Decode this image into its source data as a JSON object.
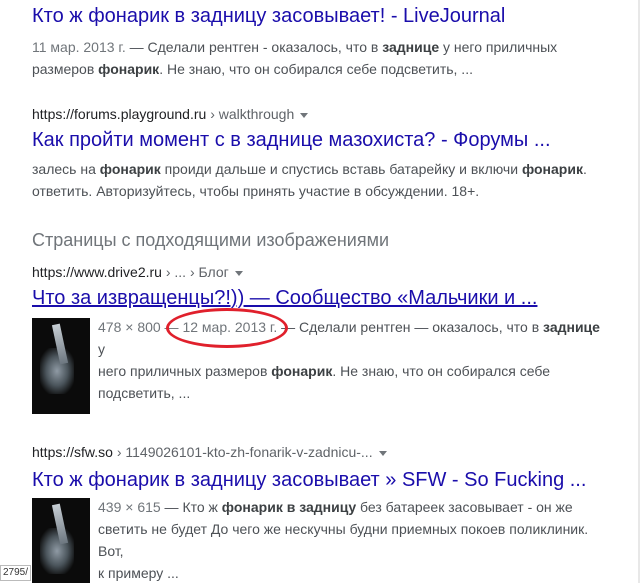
{
  "results": [
    {
      "title": "Кто ж фонарик в задницу засовывает! - LiveJournal",
      "snippet_line1": {
        "date": "11 мар. 2013 г.",
        "pre": " — Сделали рентген - оказалось, что в ",
        "bold1": "заднице",
        "post": " у него приличных"
      },
      "snippet_line2": {
        "pre": "размеров ",
        "bold1": "фонарик",
        "post": ". Не знаю, что он собирался себе подсветить, ..."
      }
    },
    {
      "url_domain": "https://forums.playground.ru",
      "url_crumb": " › walkthrough",
      "title": "Как пройти момент с в заднице мазохиста? - Форумы ...",
      "snippet_line1": {
        "pre": "залесь на ",
        "bold1": "фонарик",
        "mid": " проиди дальше и спустись вставь батарейку и включи ",
        "bold2": "фонарик",
        "post": "."
      },
      "snippet_line2": {
        "pre": "ответить. Авторизуйтесь, чтобы принять участие в обсуждении. 18+."
      }
    }
  ],
  "section_heading": "Страницы с подходящими изображениями",
  "image_results": [
    {
      "url_domain": "https://www.drive2.ru",
      "url_crumb": " › ... › Блог",
      "title": "Что за извращенцы?!)) — Сообщество «Мальчики и ...",
      "line1": {
        "size": "478 × 800",
        "dash": " — ",
        "date": "12 мар. 2013 г.",
        "pre": " — Сделали рентген — оказалось, что в ",
        "bold1": "заднице",
        "post": " у"
      },
      "line2": {
        "pre": "него приличных размеров ",
        "bold1": "фонарик",
        "post": ". Не знаю, что он собирался себе"
      },
      "line3": {
        "pre": "подсветить, ..."
      }
    },
    {
      "url_domain": "https://sfw.so",
      "url_crumb": " › 1149026101-kto-zh-fonarik-v-zadnicu-...",
      "title": "Кто ж фонарик в задницу засовывает » SFW - So Fucking ...",
      "line1": {
        "size": "439 × 615",
        "pre": " — Кто ж ",
        "bold1": "фонарик в задницу",
        "post": " без батареек засовывает - он же"
      },
      "line2": {
        "pre": "светить не будет До чего же нескучны будни приемных покоев поликлиник. Вот,"
      },
      "line3": {
        "pre": "к примеру ..."
      }
    }
  ],
  "corner_tag": "2795/",
  "colors": {
    "link": "#1a0dab",
    "snippet": "#4d5156",
    "meta": "#70757a",
    "annotation": "#e0202c"
  }
}
